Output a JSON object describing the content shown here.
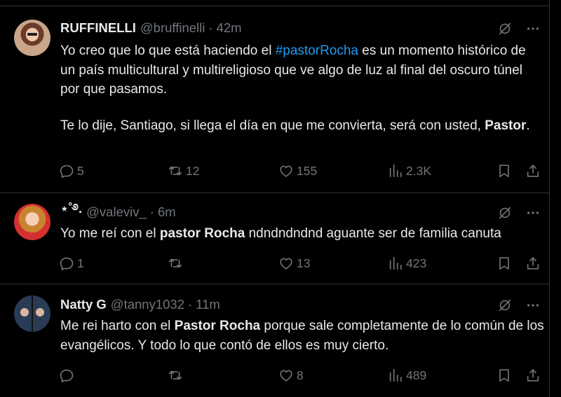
{
  "colors": {
    "background": "#000000",
    "text": "#e7e9ea",
    "muted": "#71767b",
    "link": "#1d9bf0",
    "border": "#2f3336"
  },
  "tweets": [
    {
      "name": "RUFFINELLI",
      "handle": "@bruffinelli",
      "time": "42m",
      "para1_pre": "Yo creo que lo que está haciendo el ",
      "hashtag": "#pastorRocha",
      "para1_post": " es un momento histórico de un país multicultural y multireligioso que ve algo de luz al final del oscuro túnel por que pasamos.",
      "para2_pre": "Te lo dije, Santiago, si llega el día en que me convierta, será con usted, ",
      "para2_bold": "Pastor",
      "para2_post": ".",
      "replies": "5",
      "reposts": "12",
      "likes": "155",
      "views": "2.3K"
    },
    {
      "name": "⋆˚࿔.",
      "handle": "@valeviv_",
      "time": "6m",
      "text_pre": "Yo me reí con el ",
      "text_bold": "pastor Rocha",
      "text_post": " ndndndndnd aguante ser de familia canuta",
      "replies": "1",
      "reposts": "",
      "likes": "13",
      "views": "423"
    },
    {
      "name": "Natty G",
      "handle": "@tanny1032",
      "time": "11m",
      "text_pre": "Me rei harto con el ",
      "text_bold": "Pastor Rocha",
      "text_post": " porque sale completamente de lo común de los evangélicos. Y todo lo que contó de ellos es muy cierto.",
      "replies": "",
      "reposts": "",
      "likes": "8",
      "views": "489"
    }
  ],
  "dot": "·",
  "icons": [
    "grok-icon",
    "more-icon",
    "reply-icon",
    "repost-icon",
    "like-icon",
    "views-icon",
    "bookmark-icon",
    "share-icon"
  ]
}
